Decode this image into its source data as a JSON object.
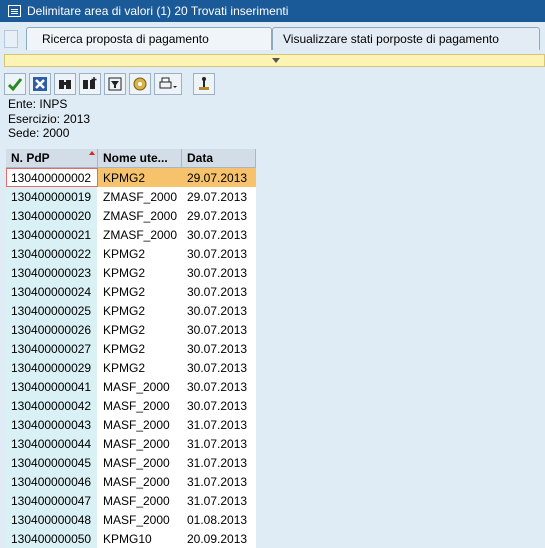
{
  "window": {
    "title": "Delimitare area di valori (1)   20 Trovati inserimenti"
  },
  "tabs": [
    {
      "label": "Ricerca proposta di pagamento"
    },
    {
      "label": "Visualizzare stati porposte di pagamento"
    }
  ],
  "toolbar": {
    "icons": [
      "check-icon",
      "cancel-icon",
      "find-icon",
      "find-next-icon",
      "filter-icon",
      "settings-icon",
      "print-icon",
      "personalize-icon"
    ]
  },
  "criteria": {
    "line1": "Ente: INPS",
    "line2": "Esercizio: 2013",
    "line3": "Sede: 2000"
  },
  "grid": {
    "headers": [
      "N. PdP",
      "Nome ute...",
      "Data"
    ],
    "rows": [
      [
        "130400000002",
        "KPMG2",
        "29.07.2013"
      ],
      [
        "130400000019",
        "ZMASF_2000",
        "29.07.2013"
      ],
      [
        "130400000020",
        "ZMASF_2000",
        "29.07.2013"
      ],
      [
        "130400000021",
        "ZMASF_2000",
        "30.07.2013"
      ],
      [
        "130400000022",
        "KPMG2",
        "30.07.2013"
      ],
      [
        "130400000023",
        "KPMG2",
        "30.07.2013"
      ],
      [
        "130400000024",
        "KPMG2",
        "30.07.2013"
      ],
      [
        "130400000025",
        "KPMG2",
        "30.07.2013"
      ],
      [
        "130400000026",
        "KPMG2",
        "30.07.2013"
      ],
      [
        "130400000027",
        "KPMG2",
        "30.07.2013"
      ],
      [
        "130400000029",
        "KPMG2",
        "30.07.2013"
      ],
      [
        "130400000041",
        "MASF_2000",
        "30.07.2013"
      ],
      [
        "130400000042",
        "MASF_2000",
        "30.07.2013"
      ],
      [
        "130400000043",
        "MASF_2000",
        "31.07.2013"
      ],
      [
        "130400000044",
        "MASF_2000",
        "31.07.2013"
      ],
      [
        "130400000045",
        "MASF_2000",
        "31.07.2013"
      ],
      [
        "130400000046",
        "MASF_2000",
        "31.07.2013"
      ],
      [
        "130400000047",
        "MASF_2000",
        "31.07.2013"
      ],
      [
        "130400000048",
        "MASF_2000",
        "01.08.2013"
      ],
      [
        "130400000050",
        "KPMG10",
        "20.09.2013"
      ]
    ]
  }
}
